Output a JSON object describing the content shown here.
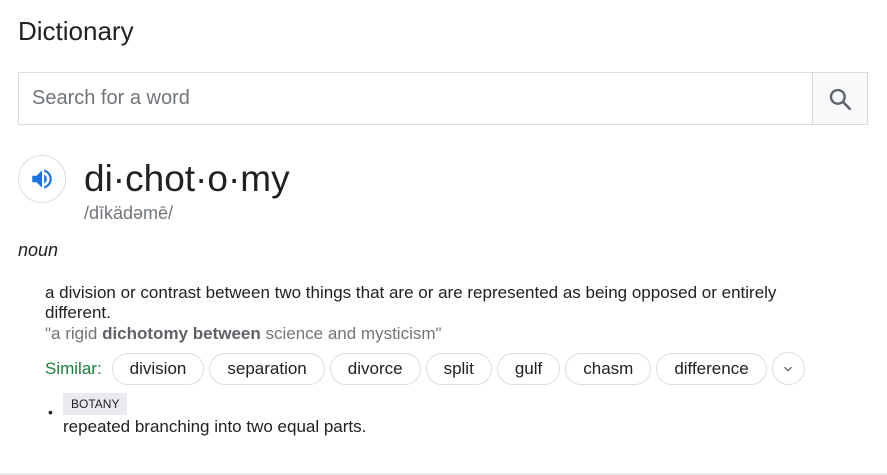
{
  "header": {
    "title": "Dictionary"
  },
  "search": {
    "placeholder": "Search for a word",
    "value": ""
  },
  "entry": {
    "headword": "di·chot·o·my",
    "phonetic": "/dīkädəmē/",
    "part_of_speech": "noun",
    "senses": [
      {
        "definition": "a division or contrast between two things that are or are represented as being opposed or entirely different.",
        "example_prefix": "\"a rigid ",
        "example_bold": "dichotomy between",
        "example_suffix": " science and mysticism\"",
        "similar_label": "Similar:",
        "similar": [
          "division",
          "separation",
          "divorce",
          "split",
          "gulf",
          "chasm",
          "difference"
        ]
      },
      {
        "bullet": "•",
        "domain": "BOTANY",
        "definition": "repeated branching into two equal parts."
      }
    ]
  },
  "colors": {
    "similar_label": "#188038",
    "speaker_icon": "#1a73e8",
    "border": "#dadce0"
  },
  "icons": {
    "speaker": "speaker-icon",
    "search": "search-icon",
    "expand": "chevron-down-icon"
  }
}
